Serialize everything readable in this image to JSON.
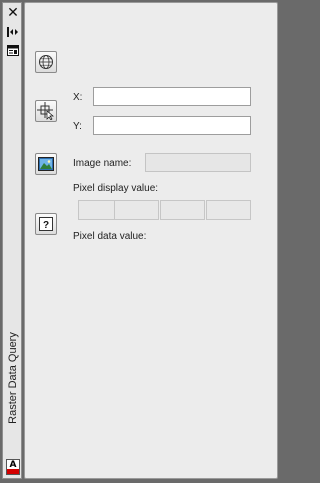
{
  "palette": {
    "panel_title": "Raster Data Query",
    "close_icon": "✕",
    "autohide_icon": "autohide-icon",
    "properties_icon": "properties-icon"
  },
  "tools": {
    "globe_button": "globe-icon",
    "pick_point_button": "crosshair-cursor-icon",
    "select_image_button": "image-icon",
    "help_button": "?"
  },
  "fields": {
    "x_label": "X:",
    "x_value": "",
    "y_label": "Y:",
    "y_value": "",
    "image_name_label": "Image name:",
    "image_name_value": "",
    "pixel_display_label": "Pixel display value:",
    "pixel_display_values": [
      "",
      "",
      "",
      ""
    ],
    "pixel_data_label": "Pixel data value:"
  },
  "colors": {
    "brand_red": "#d40000",
    "panel_bg": "#ececec",
    "border": "#9a9a9a"
  }
}
